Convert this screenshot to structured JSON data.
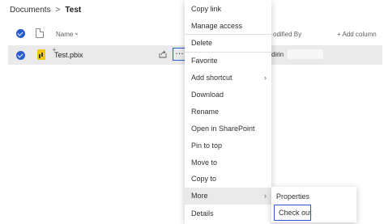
{
  "breadcrumb": {
    "root": "Documents",
    "separator": ">",
    "current": "Test"
  },
  "header": {
    "name_label": "Name",
    "sort_icon": "chevron-down-icon",
    "modified_by_label": "odified By",
    "add_column_label": "+ Add column"
  },
  "row": {
    "file_name": "Test.pbix",
    "modified_by": "dirin",
    "more_label": "…"
  },
  "menu": {
    "items": [
      {
        "label": "Copy link"
      },
      {
        "label": "Manage access"
      },
      {
        "label": "Delete"
      },
      {
        "label": "Favorite"
      },
      {
        "label": "Add shortcut"
      },
      {
        "label": "Download"
      },
      {
        "label": "Rename"
      },
      {
        "label": "Open in SharePoint"
      },
      {
        "label": "Pin to top"
      },
      {
        "label": "Move to"
      },
      {
        "label": "Copy to"
      },
      {
        "label": "More"
      },
      {
        "label": "Details"
      }
    ]
  },
  "submenu": {
    "items": [
      {
        "label": "Properties"
      },
      {
        "label": "Check out"
      }
    ]
  },
  "colors": {
    "accent": "#2b5ccd",
    "selected_row": "#eaeaea",
    "hover_item": "#eaeaea"
  }
}
